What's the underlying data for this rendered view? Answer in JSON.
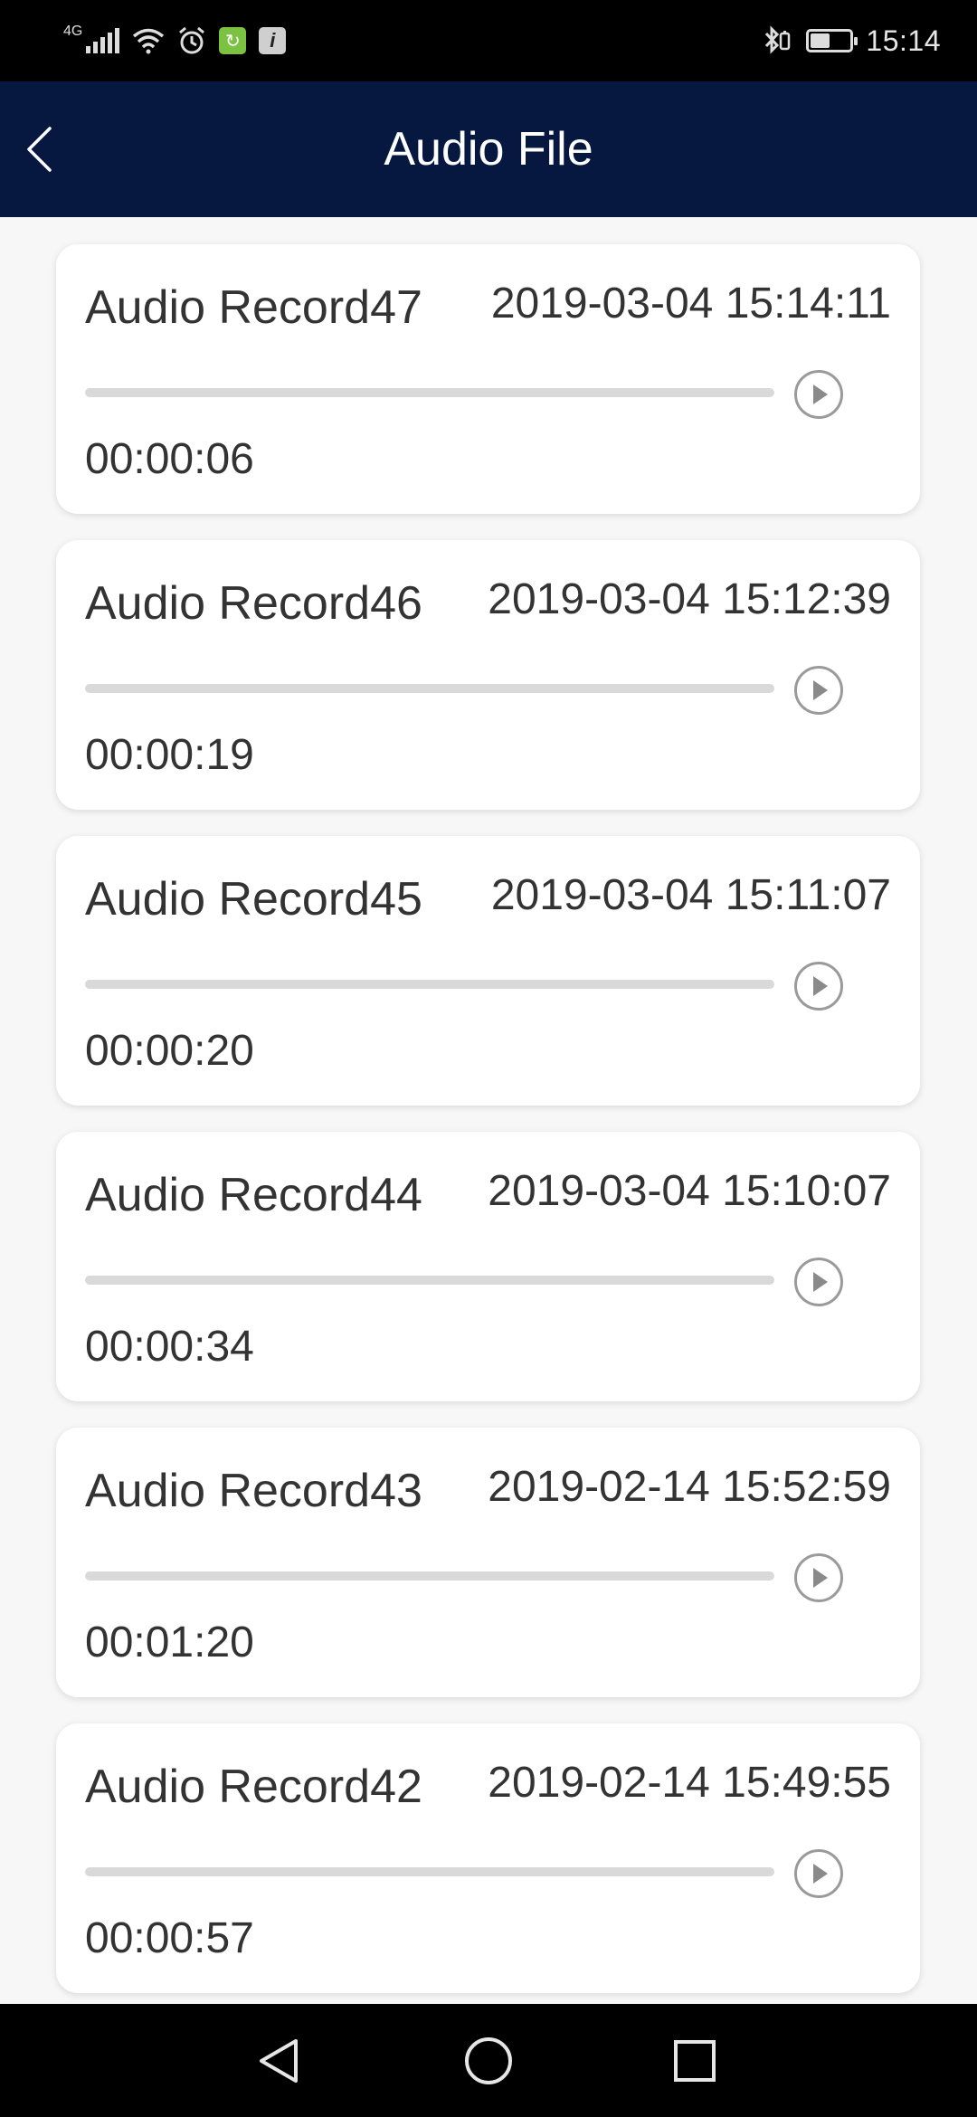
{
  "status_bar": {
    "network_type": "4G",
    "green_badge_glyph": "↻",
    "info_badge_glyph": "i",
    "time": "15:14",
    "battery_level": 0.45,
    "icons": [
      "signal-icon",
      "wifi-icon",
      "alarm-icon",
      "app-badge-icon",
      "info-icon",
      "bluetooth-icon",
      "battery-icon"
    ]
  },
  "header": {
    "title": "Audio File",
    "back_icon": "back-chevron-icon",
    "background": "#061840"
  },
  "records": [
    {
      "name": "Audio Record47",
      "date": "2019-03-04 15:14:11",
      "duration": "00:00:06",
      "progress": 0
    },
    {
      "name": "Audio Record46",
      "date": "2019-03-04 15:12:39",
      "duration": "00:00:19",
      "progress": 0
    },
    {
      "name": "Audio Record45",
      "date": "2019-03-04 15:11:07",
      "duration": "00:00:20",
      "progress": 0
    },
    {
      "name": "Audio Record44",
      "date": "2019-03-04 15:10:07",
      "duration": "00:00:34",
      "progress": 0
    },
    {
      "name": "Audio Record43",
      "date": "2019-02-14 15:52:59",
      "duration": "00:01:20",
      "progress": 0
    },
    {
      "name": "Audio Record42",
      "date": "2019-02-14 15:49:55",
      "duration": "00:00:57",
      "progress": 0
    }
  ],
  "nav_bar": {
    "back": "nav-back-icon",
    "home": "nav-home-icon",
    "recents": "nav-recents-icon"
  }
}
